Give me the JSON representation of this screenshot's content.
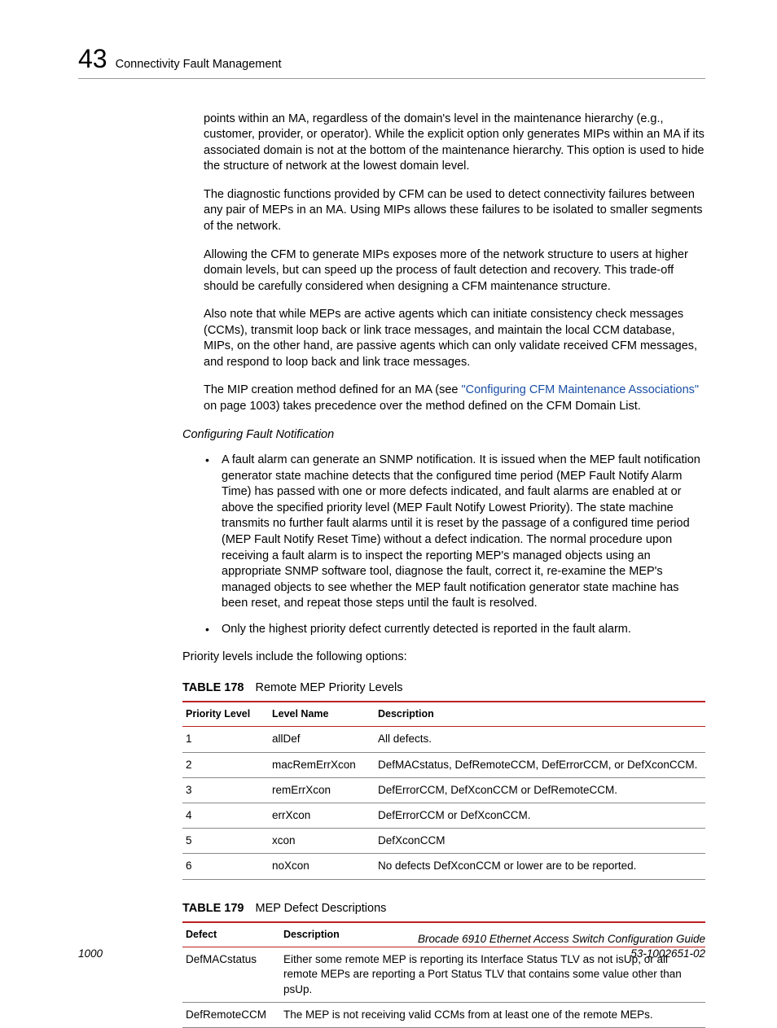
{
  "header": {
    "chapter_number": "43",
    "chapter_title": "Connectivity Fault Management"
  },
  "paragraphs": {
    "p1": "points within an MA, regardless of the domain's level in the maintenance hierarchy (e.g., customer, provider, or operator). While the explicit option only generates MIPs within an MA if its associated domain is not at the bottom of the maintenance hierarchy. This option is used to hide the structure of network at the lowest domain level.",
    "p2": "The diagnostic functions provided by CFM can be used to detect connectivity failures between any pair of MEPs in an MA. Using MIPs allows these failures to be isolated to smaller segments of the network.",
    "p3": "Allowing the CFM to generate MIPs exposes more of the network structure to users at higher domain levels, but can speed up the process of fault detection and recovery. This trade-off should be carefully considered when designing a CFM maintenance structure.",
    "p4": "Also note that while MEPs are active agents which can initiate consistency check messages (CCMs), transmit loop back or link trace messages, and maintain the local CCM database, MIPs, on the other hand, are passive agents which can only validate received CFM messages, and respond to loop back and link trace messages.",
    "p5a": "The MIP creation method defined for an MA (see ",
    "p5_link": "\"Configuring CFM Maintenance Associations\"",
    "p5b": " on page 1003) takes precedence over the method defined on the CFM Domain List.",
    "subhead": "Configuring Fault Notification",
    "b1": "A fault alarm can generate an SNMP notification. It is issued when the MEP fault notification generator state machine detects that the configured time period (MEP Fault Notify Alarm Time) has passed with one or more defects indicated, and fault alarms are enabled at or above the specified priority level (MEP Fault Notify Lowest Priority). The state machine transmits no further fault alarms until it is reset by the passage of a configured time period (MEP Fault Notify Reset Time) without a defect indication. The normal procedure upon receiving a fault alarm is to inspect the reporting MEP's managed objects using an appropriate SNMP software tool, diagnose the fault, correct it, re-examine the MEP's managed objects to see whether the MEP fault notification generator state machine has been reset, and repeat those steps until the fault is resolved.",
    "b2": "Only the highest priority defect currently detected is reported in the fault alarm.",
    "p6": "Priority levels include the following options:"
  },
  "table178": {
    "label": "TABLE 178",
    "caption": "Remote MEP Priority Levels",
    "headers": [
      "Priority Level",
      "Level Name",
      "Description"
    ],
    "rows": [
      [
        "1",
        "allDef",
        "All defects."
      ],
      [
        "2",
        "macRemErrXcon",
        "DefMACstatus, DefRemoteCCM, DefErrorCCM, or DefXconCCM."
      ],
      [
        "3",
        "remErrXcon",
        "DefErrorCCM, DefXconCCM or DefRemoteCCM."
      ],
      [
        "4",
        "errXcon",
        "DefErrorCCM or DefXconCCM."
      ],
      [
        "5",
        "xcon",
        "DefXconCCM"
      ],
      [
        "6",
        "noXcon",
        "No defects DefXconCCM or lower are to be reported."
      ]
    ]
  },
  "table179": {
    "label": "TABLE 179",
    "caption": "MEP Defect Descriptions",
    "headers": [
      "Defect",
      "Description"
    ],
    "rows": [
      [
        "DefMACstatus",
        "Either some remote MEP is reporting its Interface Status TLV as not isUp, or all remote MEPs are reporting a Port Status TLV that contains some value other than psUp."
      ],
      [
        "DefRemoteCCM",
        "The MEP is not receiving valid CCMs from at least one of the remote MEPs."
      ]
    ]
  },
  "footer": {
    "page_number": "1000",
    "doc_title": "Brocade 6910 Ethernet Access Switch Configuration Guide",
    "doc_id": "53-1002651-02"
  }
}
